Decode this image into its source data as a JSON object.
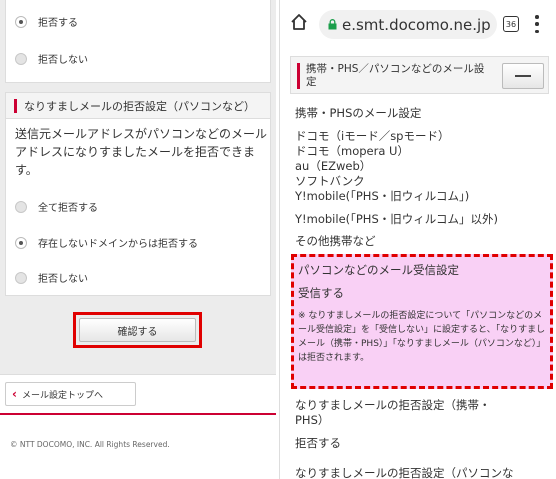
{
  "left": {
    "card1": {
      "options": [
        {
          "label": "拒否する",
          "selected": true
        },
        {
          "label": "拒否しない",
          "selected": false
        }
      ]
    },
    "card2": {
      "title": "なりすましメールの拒否設定（パソコンなど）",
      "description": "送信元メールアドレスがパソコンなどのメールアドレスになりすましたメールを拒否できます。",
      "options": [
        {
          "label": "全て拒否する",
          "selected": false
        },
        {
          "label": "存在しないドメインからは拒否する",
          "selected": true
        },
        {
          "label": "拒否しない",
          "selected": false
        }
      ]
    },
    "confirm_label": "確認する",
    "back_label": "メール設定トップへ",
    "copyright": "© NTT DOCOMO, INC. All Rights Reserved."
  },
  "right": {
    "browser": {
      "url": "e.smt.docomo.ne.jp",
      "tab_count": "36",
      "icons": [
        "home-icon",
        "lock-icon",
        "tab-switcher-icon",
        "more-vert-icon"
      ]
    },
    "section_title": "携帯・PHS／パソコンなどのメール設定",
    "mobile_setting_label": "携帯・PHSのメール設定",
    "carriers": [
      "ドコモ（iモード／spモード）",
      "ドコモ（mopera U）",
      "au（EZweb）",
      "ソフトバンク",
      "Y!mobile(「PHS・旧ウィルコム」)"
    ],
    "ymobile_other": "Y!mobile(「PHS・旧ウィルコム」以外)",
    "other_carriers": "その他携帯など",
    "pc_receive_title": "パソコンなどのメール受信設定",
    "pc_receive_value": "受信する",
    "pc_note": "※ なりすましメールの拒否設定について「パソコンなどのメール受信設定」を「受信しない」に設定すると、「なりすましメール（携帯・PHS）」「なりすましメール（パソコンなど）」は拒否されます。",
    "spoof_mobile_title": "なりすましメールの拒否設定（携帯・PHS）",
    "spoof_mobile_value": "拒否する",
    "spoof_pc_title": "なりすましメールの拒否設定（パソコンな"
  }
}
